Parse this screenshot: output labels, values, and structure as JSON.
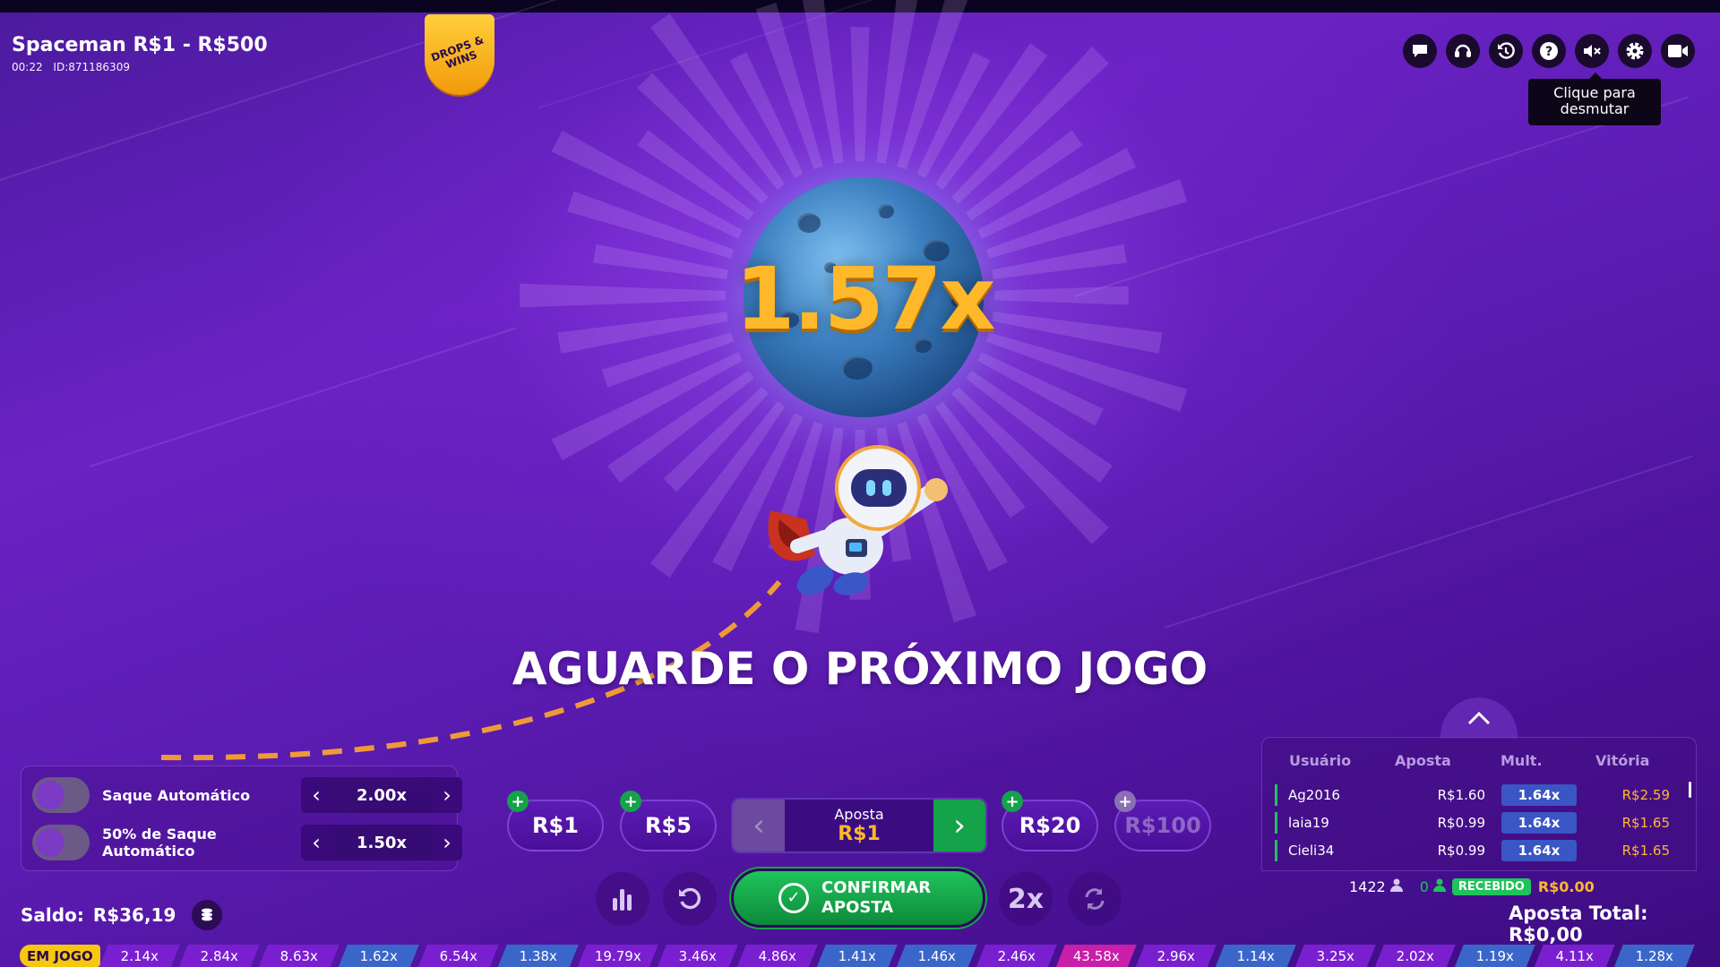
{
  "header": {
    "title": "Spaceman R$1 - R$500",
    "time": "00:22",
    "round_id": "ID:871186309",
    "badge": "DROPS & WINS"
  },
  "top_icons": [
    {
      "name": "chat-icon",
      "glyph": "▬"
    },
    {
      "name": "support-icon",
      "glyph": "☊"
    },
    {
      "name": "history-icon",
      "glyph": "↺"
    },
    {
      "name": "help-icon",
      "glyph": "?"
    },
    {
      "name": "mute-icon",
      "glyph": "✕"
    },
    {
      "name": "settings-icon",
      "glyph": "⚙"
    },
    {
      "name": "video-icon",
      "glyph": "▶"
    }
  ],
  "tooltip": "Clique para desmutar",
  "game": {
    "multiplier": "1.57x",
    "message": "AGUARDE O PRÓXIMO JOGO"
  },
  "auto": {
    "row1_label": "Saque Automático",
    "row1_value": "2.00x",
    "row2_label": "50% de Saque Automático",
    "row2_value": "1.50x"
  },
  "balance": {
    "label": "Saldo:",
    "value": "R$36,19"
  },
  "chips": [
    {
      "label": "R$1",
      "enabled": true
    },
    {
      "label": "R$5",
      "enabled": true
    },
    {
      "label": "R$20",
      "enabled": true
    },
    {
      "label": "R$100",
      "enabled": false
    }
  ],
  "bet": {
    "label": "Aposta",
    "value": "R$1"
  },
  "controls": {
    "confirm_line1": "CONFIRMAR",
    "confirm_line2": "APOSTA",
    "double_label": "2x"
  },
  "bets_table": {
    "headers": [
      "Usuário",
      "Aposta",
      "Mult.",
      "Vitória"
    ],
    "rows": [
      {
        "user": "Ag2016",
        "amount": "R$1.60",
        "mult": "1.64x",
        "win": "R$2.59"
      },
      {
        "user": "laia19",
        "amount": "R$0.99",
        "mult": "1.64x",
        "win": "R$1.65"
      },
      {
        "user": "Cieli34",
        "amount": "R$0.99",
        "mult": "1.64x",
        "win": "R$1.65"
      }
    ],
    "players": "1422",
    "received_count": "0",
    "received_label": "RECEBIDO",
    "received_total": "R$0.00",
    "total_label": "Aposta Total:",
    "total_value": "R$0,00"
  },
  "history": {
    "live_label": "EM JOGO",
    "items": [
      {
        "value": "2.14x",
        "color": "#7a1fd0"
      },
      {
        "value": "2.84x",
        "color": "#7a1fd0"
      },
      {
        "value": "8.63x",
        "color": "#7a1fd0"
      },
      {
        "value": "1.62x",
        "color": "#3b66c9"
      },
      {
        "value": "6.54x",
        "color": "#7a1fd0"
      },
      {
        "value": "1.38x",
        "color": "#3b66c9"
      },
      {
        "value": "19.79x",
        "color": "#7a1fd0"
      },
      {
        "value": "3.46x",
        "color": "#7a1fd0"
      },
      {
        "value": "4.86x",
        "color": "#7a1fd0"
      },
      {
        "value": "1.41x",
        "color": "#3b66c9"
      },
      {
        "value": "1.46x",
        "color": "#3b66c9"
      },
      {
        "value": "2.46x",
        "color": "#7a1fd0"
      },
      {
        "value": "43.58x",
        "color": "#c81ea8"
      },
      {
        "value": "2.96x",
        "color": "#7a1fd0"
      },
      {
        "value": "1.14x",
        "color": "#3b66c9"
      },
      {
        "value": "3.25x",
        "color": "#7a1fd0"
      },
      {
        "value": "2.02x",
        "color": "#7a1fd0"
      },
      {
        "value": "1.19x",
        "color": "#3b66c9"
      },
      {
        "value": "4.11x",
        "color": "#7a1fd0"
      },
      {
        "value": "1.28x",
        "color": "#3b66c9"
      }
    ]
  }
}
